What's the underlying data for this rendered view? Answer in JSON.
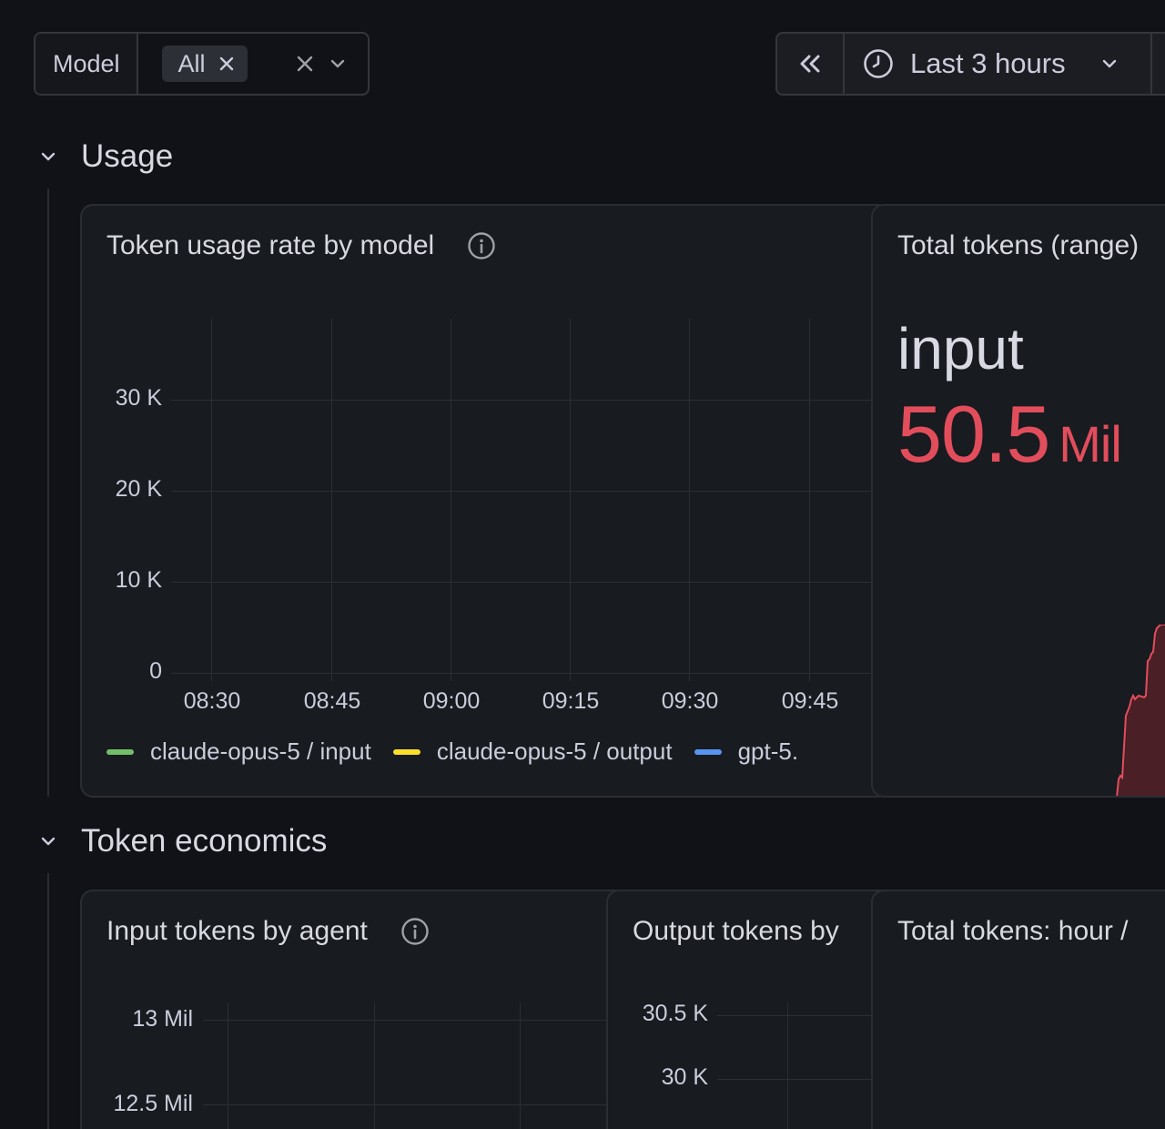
{
  "variables": {
    "model": {
      "label": "Model",
      "selected": "All"
    }
  },
  "time_picker": {
    "range": "Last 3 hours"
  },
  "rows": {
    "usage": {
      "title": "Usage"
    },
    "economics": {
      "title": "Token economics"
    }
  },
  "panels": {
    "token_rate": {
      "title": "Token usage rate by model",
      "y_ticks": [
        "30 K",
        "20 K",
        "10 K",
        "0"
      ],
      "x_ticks": [
        "08:30",
        "08:45",
        "09:00",
        "09:15",
        "09:30",
        "09:45"
      ],
      "legend": [
        {
          "label": "claude-opus-5 / input",
          "color": "#73bf69"
        },
        {
          "label": "claude-opus-5 / output",
          "color": "#fade2a"
        },
        {
          "label": "gpt-5.",
          "color": "#5794f2"
        }
      ]
    },
    "total_tokens": {
      "title": "Total tokens (range)",
      "label": "input",
      "value": "50.5",
      "unit": "Mil",
      "color": "#e24d5c"
    },
    "input_by_agent": {
      "title": "Input tokens by agent",
      "y_ticks": [
        "13 Mil",
        "12.5 Mil"
      ]
    },
    "output_by_agent": {
      "title": "Output tokens by",
      "y_ticks": [
        "30.5 K",
        "30 K"
      ]
    },
    "hourly": {
      "title": "Total tokens: hour /"
    }
  },
  "chart_data": {
    "type": "line",
    "title": "Token usage rate by model",
    "x": [
      "08:30",
      "08:45",
      "09:00",
      "09:15",
      "09:30",
      "09:45"
    ],
    "ylim": [
      0,
      35000
    ],
    "grid": true,
    "legend_position": "bottom",
    "series": [
      {
        "name": "claude-opus-5 / input",
        "values": []
      },
      {
        "name": "claude-opus-5 / output",
        "values": []
      },
      {
        "name": "gpt-5.",
        "values": []
      }
    ]
  }
}
